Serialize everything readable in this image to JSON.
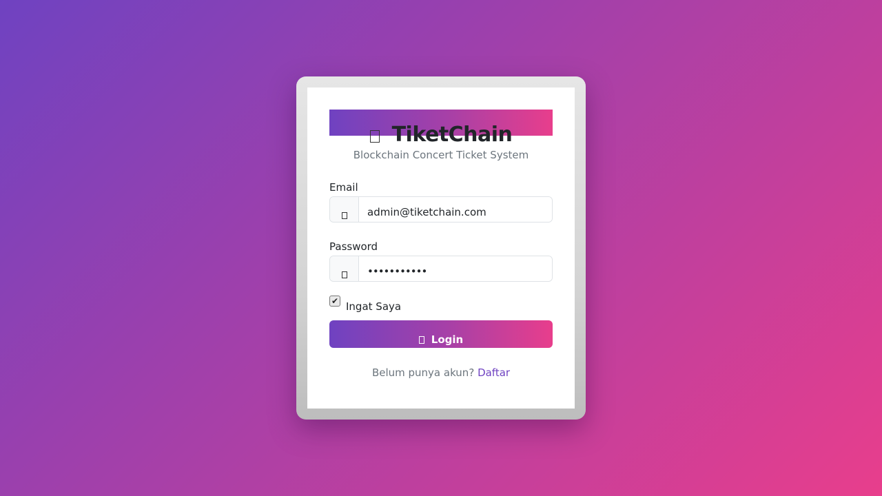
{
  "brand": {
    "name": "TiketChain",
    "subtitle": "Blockchain Concert Ticket System",
    "icon": "ticket-icon"
  },
  "form": {
    "email": {
      "label": "Email",
      "value": "admin@tiketchain.com",
      "icon": "envelope-icon"
    },
    "password": {
      "label": "Password",
      "value": "•••••••••••",
      "icon": "lock-icon"
    },
    "remember": {
      "label": "Ingat Saya",
      "checked": true
    },
    "submit": {
      "label": "Login",
      "icon": "login-icon"
    }
  },
  "footer": {
    "prompt": "Belum punya akun?",
    "link_label": "Daftar"
  },
  "colors": {
    "accent_start": "#6f42c1",
    "accent_end": "#e83e8c"
  }
}
